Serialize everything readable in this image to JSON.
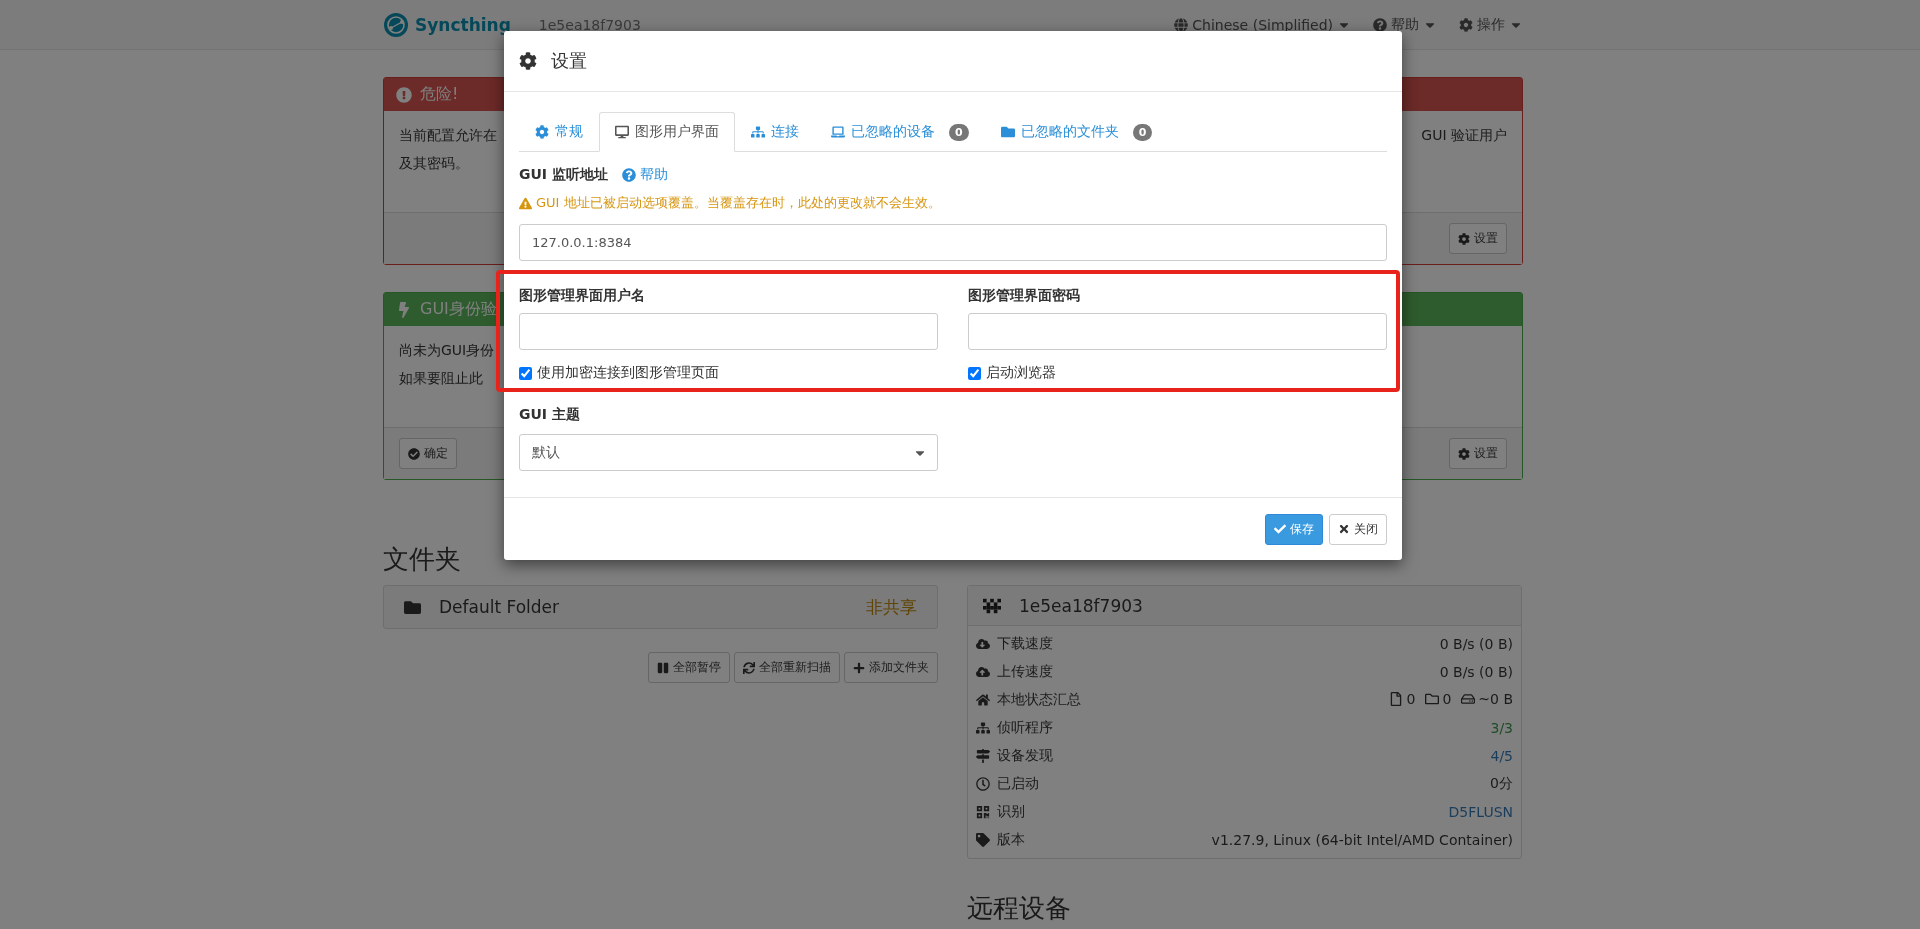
{
  "navbar": {
    "brand": "Syncthing",
    "device_name": "1e5ea18f7903",
    "menus": [
      {
        "label": "Chinese (Simplified)"
      },
      {
        "label": "帮助"
      },
      {
        "label": "操作"
      }
    ]
  },
  "alerts": [
    {
      "kind": "danger",
      "title": "危险!",
      "lines_left": [
        "当前配置允许在",
        "及其密码。"
      ],
      "text_right": "GUI 验证用户",
      "right_buttons": [
        "设置"
      ]
    },
    {
      "kind": "success",
      "title": "GUI身份验",
      "lines_left": [
        "尚未为GUI身份",
        "如果要阻止此"
      ],
      "left_buttons": [
        "确定"
      ],
      "right_buttons": [
        "设置"
      ]
    }
  ],
  "folders": {
    "heading": "文件夹",
    "items": [
      {
        "name": "Default Folder",
        "status": "非共享"
      }
    ],
    "buttons": [
      "全部暂停",
      "全部重新扫描",
      "添加文件夹"
    ]
  },
  "this_device": {
    "name": "1e5ea18f7903",
    "rows": [
      {
        "label": "下载速度",
        "value": "0 B/s (0 B)"
      },
      {
        "label": "上传速度",
        "value": "0 B/s (0 B)"
      },
      {
        "label": "本地状态汇总",
        "kind": "summary",
        "parts": [
          "0",
          "0",
          "~0 B"
        ]
      },
      {
        "label": "侦听程序",
        "value": "3/3",
        "color": "#1d4d26"
      },
      {
        "label": "设备发现",
        "value": "4/5",
        "color": "#1a3d5c"
      },
      {
        "label": "已启动",
        "value": "0分"
      },
      {
        "label": "识别",
        "value": "D5FLUSN",
        "color": "#1a3d5c"
      },
      {
        "label": "版本",
        "value": "v1.27.9, Linux (64-bit Intel/AMD Container)"
      }
    ]
  },
  "remote_devices": {
    "heading": "远程设备"
  },
  "modal": {
    "title": "设置",
    "tabs": [
      {
        "label": "常规",
        "selected": false
      },
      {
        "label": "图形用户界面",
        "selected": true
      },
      {
        "label": "连接",
        "selected": false
      },
      {
        "label": "已忽略的设备",
        "selected": false,
        "badge": "0"
      },
      {
        "label": "已忽略的文件夹",
        "selected": false,
        "badge": "0"
      }
    ],
    "listen_address": {
      "label": "GUI 监听地址",
      "help": "帮助",
      "warning": "GUI 地址已被启动选项覆盖。当覆盖存在时，此处的更改就不会生效。",
      "value": "127.0.0.1:8384"
    },
    "username": {
      "label": "图形管理界面用户名"
    },
    "password": {
      "label": "图形管理界面密码"
    },
    "checkboxes": [
      {
        "label": "使用加密连接到图形管理页面",
        "checked": true
      },
      {
        "label": "启动浏览器",
        "checked": true
      }
    ],
    "theme": {
      "label": "GUI 主题",
      "value": "默认"
    },
    "buttons": [
      {
        "label": "保存",
        "kind": "primary"
      },
      {
        "label": "关闭",
        "kind": "default"
      }
    ]
  }
}
